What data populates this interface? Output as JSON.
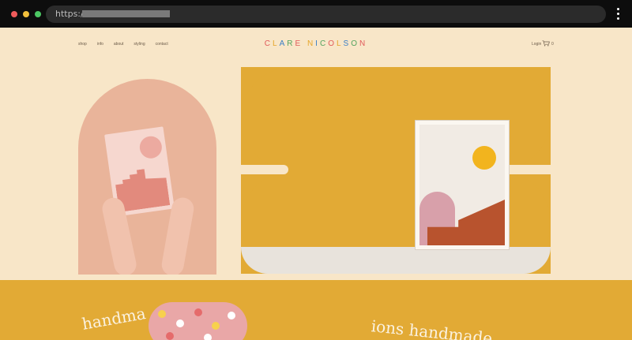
{
  "browser": {
    "url_prefix": "https://"
  },
  "nav": {
    "items": [
      "shop",
      "info",
      "about",
      "styling",
      "contact"
    ]
  },
  "brand": {
    "letters": [
      "C",
      "L",
      "A",
      "R",
      "E",
      " ",
      "N",
      "I",
      "C",
      "O",
      "L",
      "S",
      "O",
      "N"
    ],
    "colors": [
      "#e05a5a",
      "#e6a62b",
      "#3c7fc6",
      "#52a35e",
      "#e05a5a",
      "#000",
      "#e6a62b",
      "#3c7fc6",
      "#52a35e",
      "#e05a5a",
      "#e6a62b",
      "#3c7fc6",
      "#52a35e",
      "#e05a5a"
    ]
  },
  "header": {
    "login": "Login",
    "cart_count": "0"
  },
  "marquee": {
    "left": "handma",
    "right": "ions handmade"
  }
}
